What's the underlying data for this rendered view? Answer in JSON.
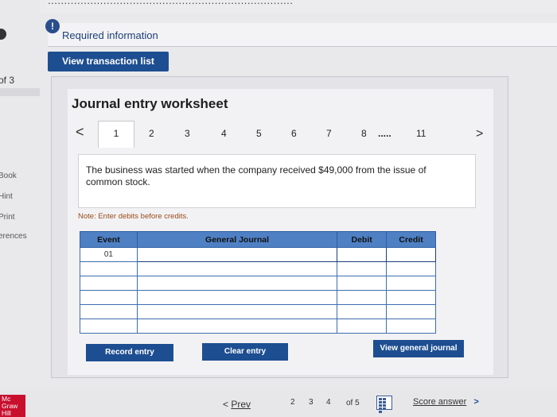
{
  "header": {
    "top_text": "...........................................................................",
    "alert_icon": "!",
    "required_tab_label": "Required information",
    "view_transaction_button": "View transaction list"
  },
  "sidebar": {
    "page_count": "of 3",
    "items": [
      "Book",
      "Hint",
      "Print",
      "erences"
    ]
  },
  "worksheet": {
    "title": "Journal entry worksheet",
    "prev_arrow": "<",
    "next_arrow": ">",
    "pages": [
      "1",
      "2",
      "3",
      "4",
      "5",
      "6",
      "7",
      "8",
      ".....",
      "11"
    ],
    "active_page": "1",
    "description": "The business was started when the company received $49,000 from the issue of common stock.",
    "note": "Note: Enter debits before credits."
  },
  "journal_table": {
    "headers": [
      "Event",
      "General Journal",
      "Debit",
      "Credit"
    ],
    "rows": [
      {
        "event": "01",
        "account": "",
        "debit": "",
        "credit": ""
      },
      {
        "event": "",
        "account": "",
        "debit": "",
        "credit": ""
      },
      {
        "event": "",
        "account": "",
        "debit": "",
        "credit": ""
      },
      {
        "event": "",
        "account": "",
        "debit": "",
        "credit": ""
      },
      {
        "event": "",
        "account": "",
        "debit": "",
        "credit": ""
      },
      {
        "event": "",
        "account": "",
        "debit": "",
        "credit": ""
      }
    ]
  },
  "buttons": {
    "record_entry": "Record entry",
    "clear_entry": "Clear entry",
    "view_general_journal": "View general journal"
  },
  "footer": {
    "brand": "Mc Graw Hill",
    "prev_label": "Prev",
    "prev_chevron": "<",
    "pages": [
      "2",
      "3",
      "4"
    ],
    "of_total": "of 5",
    "score_label": "Score answer",
    "score_chevron": ">"
  },
  "colors": {
    "primary_button": "#1d4e91",
    "table_header": "#4f80c4",
    "note_text": "#9a4a1a"
  }
}
